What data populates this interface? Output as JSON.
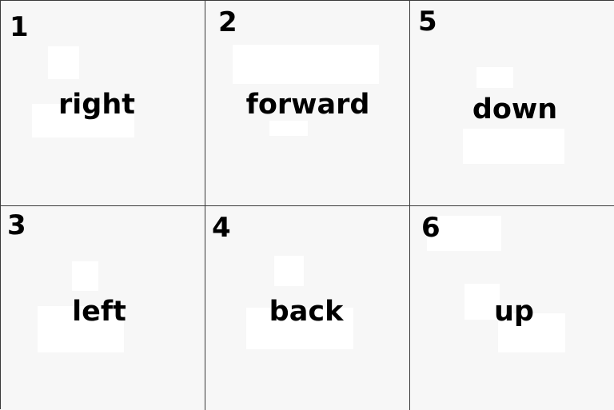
{
  "colors": {
    "background": "#f7f7f7",
    "grid_line": "#3a3a3a",
    "text": "#000000",
    "blocks": "#ffffff"
  },
  "cells": [
    {
      "number": "1",
      "label": "right"
    },
    {
      "number": "2",
      "label": "forward"
    },
    {
      "number": "5",
      "label": "down"
    },
    {
      "number": "3",
      "label": "left"
    },
    {
      "number": "4",
      "label": "back"
    },
    {
      "number": "6",
      "label": "up"
    }
  ]
}
